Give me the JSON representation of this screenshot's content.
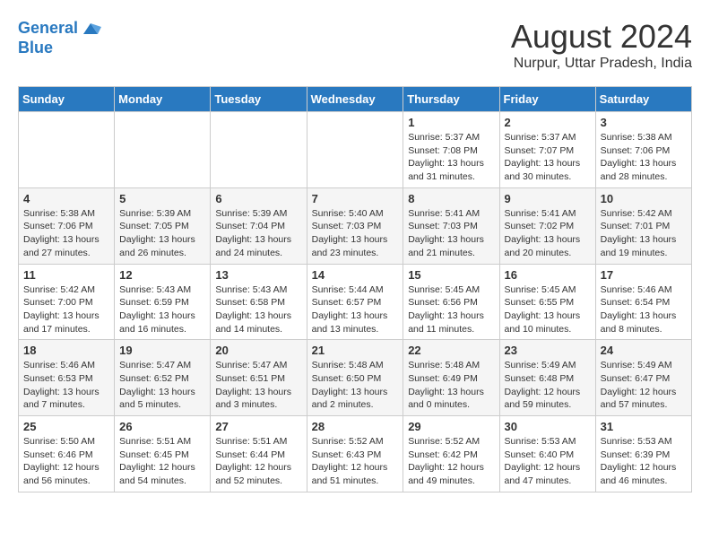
{
  "logo": {
    "line1": "General",
    "line2": "Blue"
  },
  "title": {
    "month_year": "August 2024",
    "location": "Nurpur, Uttar Pradesh, India"
  },
  "headers": [
    "Sunday",
    "Monday",
    "Tuesday",
    "Wednesday",
    "Thursday",
    "Friday",
    "Saturday"
  ],
  "weeks": [
    [
      {
        "day": "",
        "content": ""
      },
      {
        "day": "",
        "content": ""
      },
      {
        "day": "",
        "content": ""
      },
      {
        "day": "",
        "content": ""
      },
      {
        "day": "1",
        "content": "Sunrise: 5:37 AM\nSunset: 7:08 PM\nDaylight: 13 hours\nand 31 minutes."
      },
      {
        "day": "2",
        "content": "Sunrise: 5:37 AM\nSunset: 7:07 PM\nDaylight: 13 hours\nand 30 minutes."
      },
      {
        "day": "3",
        "content": "Sunrise: 5:38 AM\nSunset: 7:06 PM\nDaylight: 13 hours\nand 28 minutes."
      }
    ],
    [
      {
        "day": "4",
        "content": "Sunrise: 5:38 AM\nSunset: 7:06 PM\nDaylight: 13 hours\nand 27 minutes."
      },
      {
        "day": "5",
        "content": "Sunrise: 5:39 AM\nSunset: 7:05 PM\nDaylight: 13 hours\nand 26 minutes."
      },
      {
        "day": "6",
        "content": "Sunrise: 5:39 AM\nSunset: 7:04 PM\nDaylight: 13 hours\nand 24 minutes."
      },
      {
        "day": "7",
        "content": "Sunrise: 5:40 AM\nSunset: 7:03 PM\nDaylight: 13 hours\nand 23 minutes."
      },
      {
        "day": "8",
        "content": "Sunrise: 5:41 AM\nSunset: 7:03 PM\nDaylight: 13 hours\nand 21 minutes."
      },
      {
        "day": "9",
        "content": "Sunrise: 5:41 AM\nSunset: 7:02 PM\nDaylight: 13 hours\nand 20 minutes."
      },
      {
        "day": "10",
        "content": "Sunrise: 5:42 AM\nSunset: 7:01 PM\nDaylight: 13 hours\nand 19 minutes."
      }
    ],
    [
      {
        "day": "11",
        "content": "Sunrise: 5:42 AM\nSunset: 7:00 PM\nDaylight: 13 hours\nand 17 minutes."
      },
      {
        "day": "12",
        "content": "Sunrise: 5:43 AM\nSunset: 6:59 PM\nDaylight: 13 hours\nand 16 minutes."
      },
      {
        "day": "13",
        "content": "Sunrise: 5:43 AM\nSunset: 6:58 PM\nDaylight: 13 hours\nand 14 minutes."
      },
      {
        "day": "14",
        "content": "Sunrise: 5:44 AM\nSunset: 6:57 PM\nDaylight: 13 hours\nand 13 minutes."
      },
      {
        "day": "15",
        "content": "Sunrise: 5:45 AM\nSunset: 6:56 PM\nDaylight: 13 hours\nand 11 minutes."
      },
      {
        "day": "16",
        "content": "Sunrise: 5:45 AM\nSunset: 6:55 PM\nDaylight: 13 hours\nand 10 minutes."
      },
      {
        "day": "17",
        "content": "Sunrise: 5:46 AM\nSunset: 6:54 PM\nDaylight: 13 hours\nand 8 minutes."
      }
    ],
    [
      {
        "day": "18",
        "content": "Sunrise: 5:46 AM\nSunset: 6:53 PM\nDaylight: 13 hours\nand 7 minutes."
      },
      {
        "day": "19",
        "content": "Sunrise: 5:47 AM\nSunset: 6:52 PM\nDaylight: 13 hours\nand 5 minutes."
      },
      {
        "day": "20",
        "content": "Sunrise: 5:47 AM\nSunset: 6:51 PM\nDaylight: 13 hours\nand 3 minutes."
      },
      {
        "day": "21",
        "content": "Sunrise: 5:48 AM\nSunset: 6:50 PM\nDaylight: 13 hours\nand 2 minutes."
      },
      {
        "day": "22",
        "content": "Sunrise: 5:48 AM\nSunset: 6:49 PM\nDaylight: 13 hours\nand 0 minutes."
      },
      {
        "day": "23",
        "content": "Sunrise: 5:49 AM\nSunset: 6:48 PM\nDaylight: 12 hours\nand 59 minutes."
      },
      {
        "day": "24",
        "content": "Sunrise: 5:49 AM\nSunset: 6:47 PM\nDaylight: 12 hours\nand 57 minutes."
      }
    ],
    [
      {
        "day": "25",
        "content": "Sunrise: 5:50 AM\nSunset: 6:46 PM\nDaylight: 12 hours\nand 56 minutes."
      },
      {
        "day": "26",
        "content": "Sunrise: 5:51 AM\nSunset: 6:45 PM\nDaylight: 12 hours\nand 54 minutes."
      },
      {
        "day": "27",
        "content": "Sunrise: 5:51 AM\nSunset: 6:44 PM\nDaylight: 12 hours\nand 52 minutes."
      },
      {
        "day": "28",
        "content": "Sunrise: 5:52 AM\nSunset: 6:43 PM\nDaylight: 12 hours\nand 51 minutes."
      },
      {
        "day": "29",
        "content": "Sunrise: 5:52 AM\nSunset: 6:42 PM\nDaylight: 12 hours\nand 49 minutes."
      },
      {
        "day": "30",
        "content": "Sunrise: 5:53 AM\nSunset: 6:40 PM\nDaylight: 12 hours\nand 47 minutes."
      },
      {
        "day": "31",
        "content": "Sunrise: 5:53 AM\nSunset: 6:39 PM\nDaylight: 12 hours\nand 46 minutes."
      }
    ]
  ]
}
